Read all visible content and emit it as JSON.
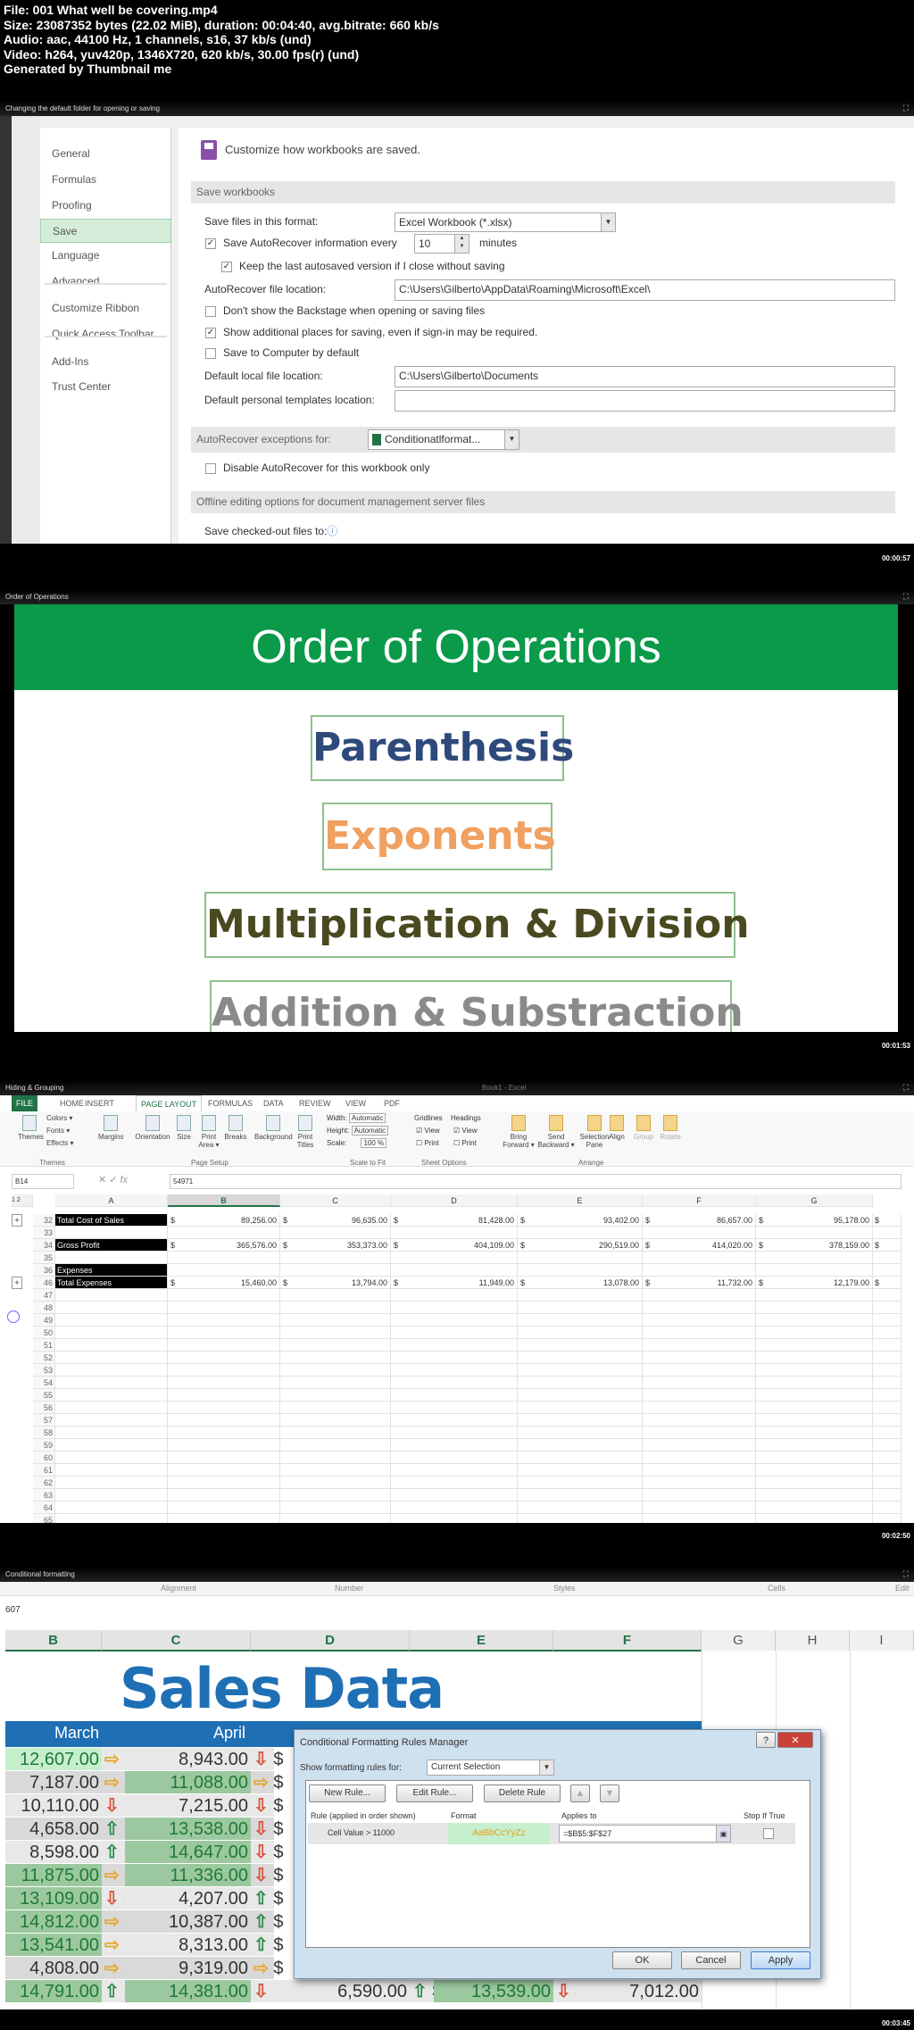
{
  "header": {
    "lines": [
      "File: 001 What well be covering.mp4",
      "Size: 23087352 bytes (22.02 MiB), duration: 00:04:40, avg.bitrate: 660 kb/s",
      "Audio: aac, 44100 Hz, 1 channels, s16, 37 kb/s (und)",
      "Video: h264, yuv420p, 1346X720, 620 kb/s, 30.00 fps(r) (und)",
      "Generated by Thumbnail me"
    ]
  },
  "timestamps": [
    "00:00:57",
    "00:01:53",
    "00:02:50",
    "00:03:45"
  ],
  "panel1": {
    "title": "Changing the default folder for opening or saving",
    "nav": [
      {
        "label": "General"
      },
      {
        "label": "Formulas"
      },
      {
        "label": "Proofing"
      },
      {
        "label": "Save",
        "selected": true
      },
      {
        "label": "Language"
      },
      {
        "label": "Advanced"
      },
      {
        "label": "Customize Ribbon"
      },
      {
        "label": "Quick Access Toolbar"
      },
      {
        "label": "Add-Ins"
      },
      {
        "label": "Trust Center"
      }
    ],
    "heading": "Customize how workbooks are saved.",
    "section_save": "Save workbooks",
    "format_label": "Save files in this format:",
    "format_value": "Excel Workbook (*.xlsx)",
    "autorecover_label": "Save AutoRecover information every",
    "autorecover_checked": true,
    "autorecover_minutes": "10",
    "minutes_label": "minutes",
    "keep_label": "Keep the last autosaved version if I close without saving",
    "keep_checked": true,
    "ar_location_label": "AutoRecover file location:",
    "ar_location": "C:\\Users\\Gilberto\\AppData\\Roaming\\Microsoft\\Excel\\",
    "backstage_label": "Don't show the Backstage when opening or saving files",
    "backstage_checked": false,
    "additional_label": "Show additional places for saving, even if sign-in may be required.",
    "additional_checked": true,
    "computer_label": "Save to Computer by default",
    "computer_checked": false,
    "local_label": "Default local file location:",
    "local_value": "C:\\Users\\Gilberto\\Documents",
    "templates_label": "Default personal templates location:",
    "templates_value": "",
    "exceptions_label": "AutoRecover exceptions for:",
    "exceptions_value": "Conditionatlformat...",
    "disable_label": "Disable AutoRecover for this workbook only",
    "disable_checked": false,
    "section_offline": "Offline editing options for document management server files",
    "checked_out_label": "Save checked-out files to:"
  },
  "panel2": {
    "title": "Order of Operations",
    "heading": "Order of Operations",
    "items": [
      {
        "label": "Parenthesis",
        "color": "#2e4a7a"
      },
      {
        "label": "Exponents",
        "color": "#f0a060"
      },
      {
        "label": "Multiplication & Division",
        "color": "#4a4a20"
      },
      {
        "label": "Addition & Substraction",
        "color": "#8a8a8a"
      }
    ]
  },
  "panel3": {
    "title": "Hiding & Grouping",
    "window_title": "Book1 - Excel",
    "tabs": [
      "FILE",
      "HOME",
      "INSERT",
      "PAGE LAYOUT",
      "FORMULAS",
      "DATA",
      "REVIEW",
      "VIEW",
      "PDF"
    ],
    "active_tab": "PAGE LAYOUT",
    "ribbon": {
      "themes": [
        "Themes",
        "Colors ▾",
        "Fonts ▾",
        "Effects ▾"
      ],
      "page_setup": [
        "Margins",
        "Orientation",
        "Size",
        "Print Area ▾",
        "Breaks",
        "Background",
        "Print Titles"
      ],
      "width_label": "Width:",
      "width_value": "Automatic",
      "height_label": "Height:",
      "height_value": "Automatic",
      "scale_label": "Scale:",
      "scale_value": "100 %",
      "gridlines": "Gridlines",
      "headings": "Headings",
      "view": "View",
      "print": "Print",
      "arrange": [
        "Bring Forward ▾",
        "Send Backward ▾",
        "Selection Pane",
        "Align",
        "Group",
        "Rotate"
      ],
      "groups": [
        "Themes",
        "Page Setup",
        "Scale to Fit",
        "Sheet Options",
        "Arrange"
      ]
    },
    "name_box": "B14",
    "formula": "54971",
    "columns": [
      "A",
      "B",
      "C",
      "D",
      "E",
      "F",
      "G"
    ],
    "rows": [
      {
        "n": "32",
        "label": "Total Cost of Sales",
        "values": [
          "89,256.00",
          "96,635.00",
          "81,428.00",
          "93,402.00",
          "86,657.00",
          "95,178.00"
        ],
        "group": true
      },
      {
        "n": "33"
      },
      {
        "n": "34",
        "label": "Gross Profit",
        "values": [
          "365,576.00",
          "353,373.00",
          "404,109.00",
          "290,519.00",
          "414,020.00",
          "378,159.00"
        ]
      },
      {
        "n": "35"
      },
      {
        "n": "36",
        "label": "Expenses"
      },
      {
        "n": "46",
        "label": "Total Expenses",
        "values": [
          "15,460.00",
          "13,794.00",
          "11,949.00",
          "13,078.00",
          "11,732.00",
          "12,179.00"
        ],
        "group": true
      },
      {
        "n": "47"
      },
      {
        "n": "48"
      },
      {
        "n": "49"
      },
      {
        "n": "50"
      },
      {
        "n": "51"
      },
      {
        "n": "52"
      },
      {
        "n": "53"
      },
      {
        "n": "54"
      },
      {
        "n": "55"
      },
      {
        "n": "56"
      },
      {
        "n": "57"
      },
      {
        "n": "58"
      },
      {
        "n": "59"
      },
      {
        "n": "60"
      },
      {
        "n": "61"
      },
      {
        "n": "62"
      },
      {
        "n": "63"
      },
      {
        "n": "64"
      },
      {
        "n": "65"
      }
    ]
  },
  "panel4": {
    "title": "Conditional formatting",
    "ribbon_groups": [
      "Alignment",
      "Number",
      "Styles",
      "Cells",
      "Edit"
    ],
    "formula_fragment": "607",
    "columns": [
      "B",
      "C",
      "D",
      "E",
      "F",
      "G",
      "H",
      "I"
    ],
    "sheet_title": "Sales Data",
    "month_headers": [
      "March",
      "April"
    ],
    "rows": [
      {
        "b": "12,607.00",
        "ba": "right",
        "c": "8,943.00",
        "ca": "down"
      },
      {
        "b": "7,187.00",
        "ba": "right",
        "c": "11,088.00",
        "ca": "right"
      },
      {
        "b": "10,110.00",
        "ba": "down",
        "c": "7,215.00",
        "ca": "down"
      },
      {
        "b": "4,658.00",
        "ba": "up",
        "c": "13,538.00",
        "ca": "down"
      },
      {
        "b": "8,598.00",
        "ba": "up",
        "c": "14,647.00",
        "ca": "down"
      },
      {
        "b": "11,875.00",
        "ba": "right",
        "c": "11,336.00",
        "ca": "down"
      },
      {
        "b": "13,109.00",
        "ba": "down",
        "c": "4,207.00",
        "ca": "up"
      },
      {
        "b": "14,812.00",
        "ba": "right",
        "c": "10,387.00",
        "ca": "up"
      },
      {
        "b": "13,541.00",
        "ba": "right",
        "c": "8,313.00",
        "ca": "up"
      },
      {
        "b": "4,808.00",
        "ba": "right",
        "c": "9,319.00",
        "ca": "right"
      },
      {
        "b": "14,791.00",
        "ba": "up",
        "c": "14,381.00",
        "ca": "down",
        "d": "6,590.00",
        "da": "up",
        "e": "13,539.00",
        "ea": "down",
        "f": "7,012.00"
      }
    ],
    "dialog": {
      "title": "Conditional Formatting Rules Manager",
      "show_label": "Show formatting rules for:",
      "show_value": "Current Selection",
      "new_rule": "New Rule...",
      "edit_rule": "Edit Rule...",
      "delete_rule": "Delete Rule",
      "col_rule": "Rule (applied in order shown)",
      "col_format": "Format",
      "col_applies": "Applies to",
      "col_stop": "Stop If True",
      "rule": "Cell Value > 11000",
      "format_preview": "AaBbCcYyZz",
      "applies_to": "=$B$5:$F$27",
      "ok": "OK",
      "cancel": "Cancel",
      "apply": "Apply"
    }
  },
  "colors": {
    "excel_green": "#217346",
    "slide_green": "#0a9a4a",
    "sales_blue": "#1f6fb5",
    "highlight_green": "#c6efce"
  }
}
